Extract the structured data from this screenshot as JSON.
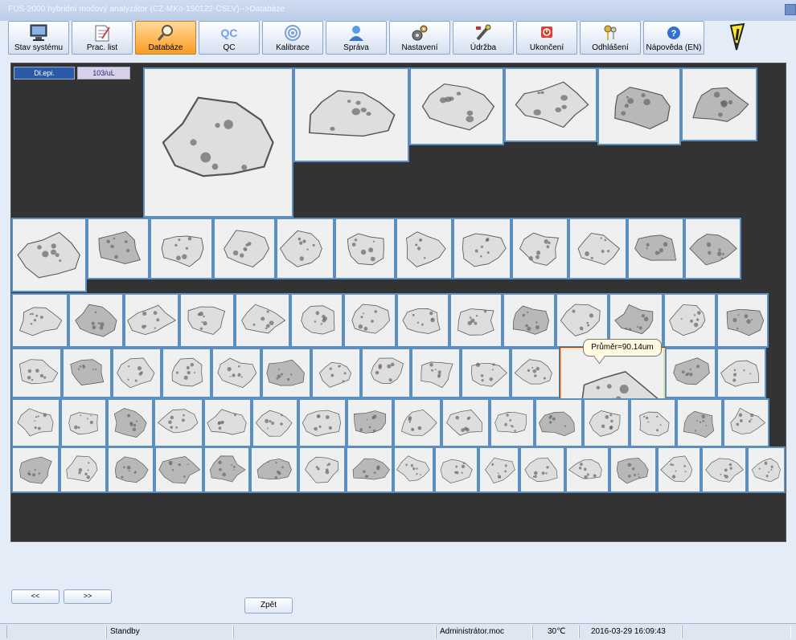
{
  "window": {
    "title": "FUS-2000 hybridní močový analyzátor (CZ-MKo-150122-CSLV)-->Databáze"
  },
  "toolbar": {
    "buttons": [
      {
        "label": "Stav systému",
        "icon": "monitor-icon",
        "active": false
      },
      {
        "label": "Prac. list",
        "icon": "worklist-icon",
        "active": false
      },
      {
        "label": "Databáze",
        "icon": "magnifier-icon",
        "active": true
      },
      {
        "label": "QC",
        "icon": "qc-icon",
        "active": false
      },
      {
        "label": "Kalibrace",
        "icon": "calibration-icon",
        "active": false
      },
      {
        "label": "Správa",
        "icon": "user-icon",
        "active": false
      },
      {
        "label": "Nastavení",
        "icon": "gears-icon",
        "active": false
      },
      {
        "label": "Údržba",
        "icon": "wrench-icon",
        "active": false
      },
      {
        "label": "Ukončení",
        "icon": "power-icon",
        "active": false
      },
      {
        "label": "Odhlášení",
        "icon": "keys-icon",
        "active": false
      },
      {
        "label": "Nápověda (EN)",
        "icon": "help-icon",
        "active": false
      }
    ],
    "qc_glyph": "QC"
  },
  "gallery": {
    "cell_type": "Dl.epi.",
    "unit": "103/uL",
    "tooltip": "Průměr=90.14um",
    "cell_count": 88
  },
  "nav": {
    "prev": "<<",
    "next": ">>",
    "back": "Zpět"
  },
  "status": {
    "state": "Standby",
    "user": "Administrátor.moc",
    "temperature": "30℃",
    "datetime": "2016-03-29 16:09:43"
  },
  "colors": {
    "panel_bg": "#333333",
    "cell_border": "#5b8fc2",
    "active_tab": "#ffb857",
    "selected_cell_border": "#b02020"
  }
}
